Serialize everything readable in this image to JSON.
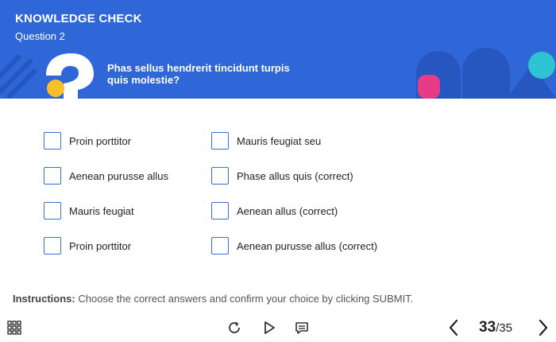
{
  "header": {
    "title": "KNOWLEDGE CHECK",
    "subtitle": "Question 2",
    "question": "Phas sellus hendrerit tincidunt turpis quis molestie?",
    "accent_color": "#2f66d8"
  },
  "options": {
    "col1": [
      {
        "label": "Proin porttitor",
        "checked": false
      },
      {
        "label": "Aenean purusse allus",
        "checked": false
      },
      {
        "label": "Mauris feugiat",
        "checked": false
      },
      {
        "label": "Proin porttitor",
        "checked": false
      }
    ],
    "col2": [
      {
        "label": "Mauris feugiat seu",
        "checked": false
      },
      {
        "label": "Phase allus quis (correct)",
        "checked": false
      },
      {
        "label": "Aenean allus (correct)",
        "checked": false
      },
      {
        "label": "Aenean purusse allus (correct)",
        "checked": false
      }
    ]
  },
  "instructions": {
    "prefix": "Instructions:",
    "text": " Choose the correct answers and confirm your choice by clicking SUBMIT."
  },
  "footer": {
    "menu_icon": "grid-menu-icon",
    "replay_icon": "replay-icon",
    "play_icon": "play-icon",
    "notes_icon": "notes-icon",
    "prev_icon": "chevron-left-icon",
    "next_icon": "chevron-right-icon",
    "current_page": "33",
    "total_pages": "/35"
  }
}
